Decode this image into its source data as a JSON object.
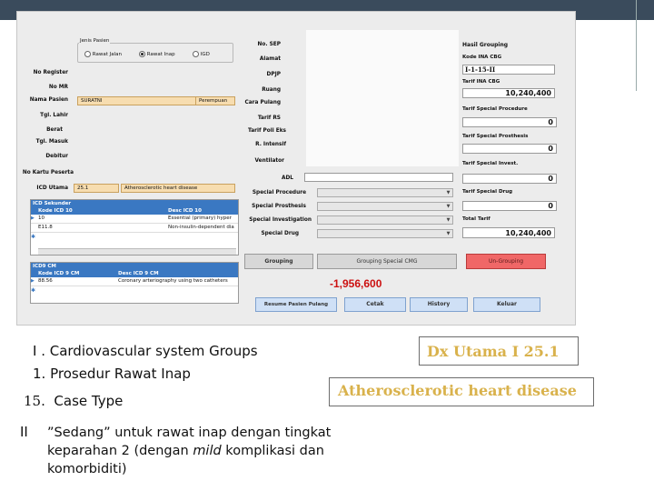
{
  "app": {
    "jenis_pasien": {
      "legend": "Jenis Pasien",
      "options": [
        "Rawat Jalan",
        "Rawat Inap",
        "IGD"
      ],
      "selected": "Rawat Inap"
    },
    "left_labels": {
      "no_register": "No Register",
      "no_mr": "No MR",
      "nama_pasien": "Nama Pasien",
      "tgl_lahir": "Tgl. Lahir",
      "berat": "Berat",
      "tgl_masuk": "Tgl. Masuk",
      "debitur": "Debitur",
      "no_kartu": "No Kartu Peserta",
      "icd_utama": "ICD Utama"
    },
    "nama_pasien_value": "SURATNI",
    "gender_value": "Perempuan",
    "icd_utama_code": "25.1",
    "icd_utama_desc": "Atherosclerotic heart disease",
    "icd_sekunder": {
      "title": "ICD Sekunder",
      "col_code": "Kode ICD 10",
      "col_desc": "Desc ICD 10",
      "rows": [
        {
          "code": "10",
          "desc": "Essential (primary) hyper"
        },
        {
          "code": "E11.8",
          "desc": "Non-insulin-dependent dia"
        }
      ]
    },
    "icd9": {
      "title": "ICD9 CM",
      "col_code": "Kode ICD 9 CM",
      "col_desc": "Desc ICD 9 CM",
      "rows": [
        {
          "code": "88.56",
          "desc": "Coronary arteriography using two catheters"
        }
      ]
    },
    "mid_labels": {
      "no_sep": "No. SEP",
      "alamat": "Alamat",
      "dpjp": "DPJP",
      "ruang": "Ruang",
      "cara_pulang": "Cara Pulang",
      "tarif_rs": "Tarif RS",
      "tarif_poli": "Tarif Poli Eks",
      "r_intensif": "R. Intensif",
      "ventilator": "Ventilator",
      "adl": "ADL",
      "special_procedure": "Special Procedure",
      "special_prosthesis": "Special Prosthesis",
      "special_investigation": "Special Investigation",
      "special_drug": "Special Drug"
    },
    "right": {
      "hasil_grouping": "Hasil Grouping",
      "kode_ina_cbg_label": "Kode INA CBG",
      "kode_ina_cbg": "I-1-15-II",
      "tarif_ina_cbg_label": "Tarif INA CBG",
      "tarif_ina_cbg": "10,240,400",
      "tarif_special_procedure_label": "Tarif Special Procedure",
      "tarif_special_procedure": "0",
      "tarif_special_prosthesis_label": "Tarif Special Prosthesis",
      "tarif_special_prosthesis": "0",
      "tarif_special_invest_label": "Tarif Special Invest.",
      "tarif_special_invest": "0",
      "tarif_special_drug_label": "Tarif Special Drug",
      "tarif_special_drug": "0",
      "total_tarif_label": "Total Tarif",
      "total_tarif": "10,240,400"
    },
    "buttons": {
      "grouping": "Grouping",
      "grouping_special": "Grouping Special CMG",
      "ungrouping": "Un-Grouping",
      "resume": "Resume Pasien Pulang",
      "cetak": "Cetak",
      "history": "History",
      "keluar": "Keluar"
    },
    "difference": "-1,956,600"
  },
  "slide": {
    "line1": "I . Cardiovascular system Groups",
    "line2": "1. Prosedur Rawat Inap",
    "line3_num": "15.",
    "line3_text": "Case Type",
    "bullet": "II",
    "para_line1": "”Sedang” untuk rawat inap dengan tingkat",
    "para_line2_pre": "keparahan 2 (dengan ",
    "para_line2_em": "mild",
    "para_line2_post": " komplikasi dan",
    "para_line3": "komorbiditi)",
    "dx_utama": "Dx Utama   I 25.1",
    "dx_desc": "Atherosclerotic heart disease"
  },
  "colors": {
    "topbar": "#3a4b5c",
    "grid_header": "#3a78c2",
    "ungrouping_button": "#f06767",
    "difference_text": "#cc1111",
    "dx_text": "#d9b24c"
  }
}
